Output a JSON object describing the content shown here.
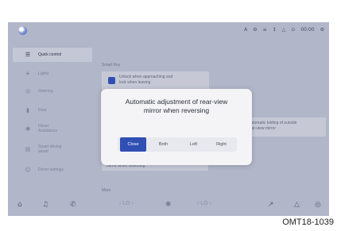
{
  "top_status": {
    "icons": [
      "A",
      "⚙",
      "≡",
      "↕",
      "△",
      "⊙",
      "00:00",
      "⚙"
    ]
  },
  "sidebar": {
    "items": [
      {
        "label": "Quick control",
        "icon": "☰"
      },
      {
        "label": "Lights",
        "icon": "☀"
      },
      {
        "label": "Steering",
        "icon": "◎"
      },
      {
        "label": "Door",
        "icon": "▮"
      },
      {
        "label": "Driver\nAssistance",
        "icon": "◉"
      },
      {
        "label": "Smart driving\nassist",
        "icon": "▤"
      },
      {
        "label": "Driver settings",
        "icon": "☺"
      }
    ]
  },
  "main": {
    "section_smart_key": "Smart Key",
    "unlock_card": "Unlock when approaching and\nlock when leaving",
    "right_card": "Automatic folding of outside\nrear-view mirror",
    "adjust_card": "Automatic adjustment of rear-view\nmirror when reversing",
    "section_more": "More"
  },
  "bottombar": {
    "home_icon": "⌂",
    "media_icon": "♫",
    "phone_icon": "✆",
    "left_temp": "‹  LO  ›",
    "fan_icon": "❄",
    "right_temp": "‹  LO  ›",
    "seat_icon": "↗",
    "warning_icon": "△",
    "settings_icon": "◎"
  },
  "modal": {
    "title": "Automatic adjustment of rear-view\nmirror when reversing",
    "options": [
      "Close",
      "Both",
      "Left",
      "Right"
    ],
    "selected": "Close"
  },
  "caption": "OMT18-1039",
  "colors": {
    "accent": "#2f4fb3",
    "screen_bg": "#b1b6c8",
    "modal_bg": "#f4f4f7"
  }
}
